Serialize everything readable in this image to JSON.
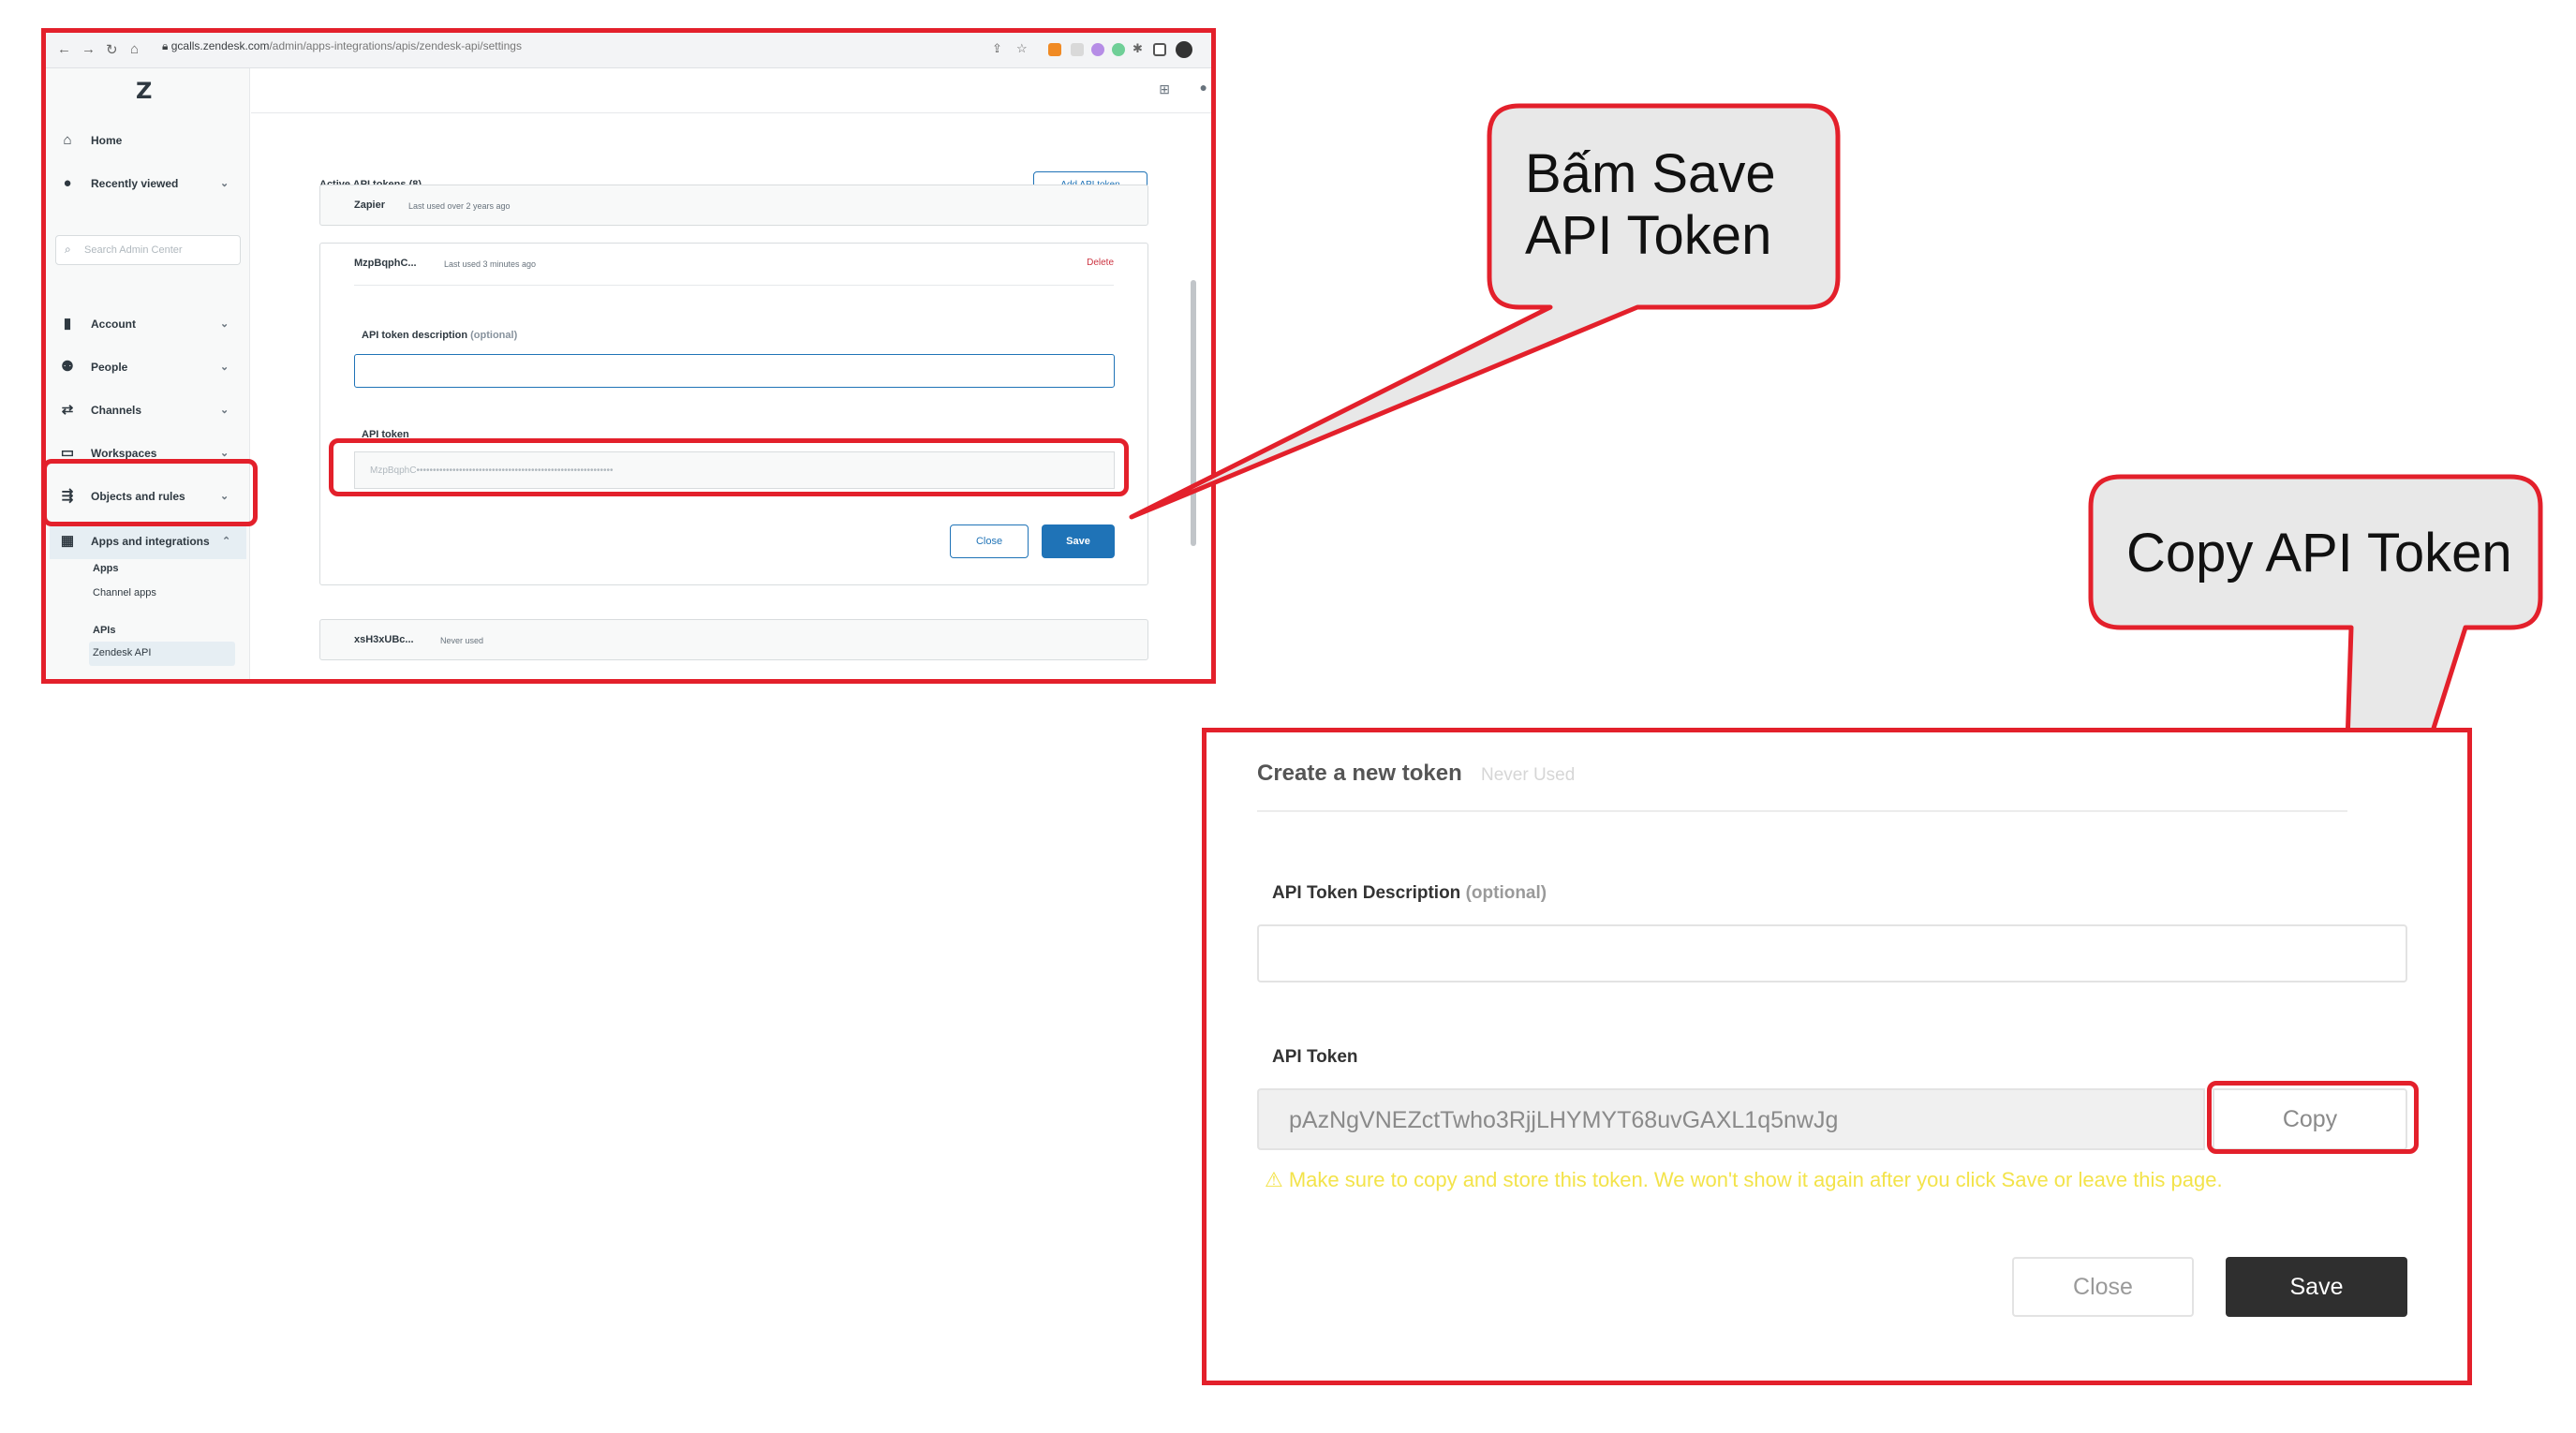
{
  "browser": {
    "url_host": "gcalls.zendesk.com",
    "url_path": "/admin/apps-integrations/apis/zendesk-api/settings"
  },
  "sidebar": {
    "logo": "Z",
    "search_placeholder": "Search Admin Center",
    "items": [
      {
        "label": "Home",
        "icon": "home-icon"
      },
      {
        "label": "Recently viewed",
        "icon": "clock-icon"
      },
      {
        "label": "Account",
        "icon": "building-icon"
      },
      {
        "label": "People",
        "icon": "people-icon"
      },
      {
        "label": "Channels",
        "icon": "arrows-icon"
      },
      {
        "label": "Workspaces",
        "icon": "monitor-icon"
      },
      {
        "label": "Objects and rules",
        "icon": "flow-icon"
      },
      {
        "label": "Apps and integrations",
        "icon": "grid-icon"
      }
    ],
    "sub": {
      "apps": "Apps",
      "channel_apps": "Channel apps",
      "apis": "APIs",
      "zendesk_api": "Zendesk API"
    }
  },
  "main": {
    "active_header": "Active API tokens (8)",
    "add_token": "Add API token",
    "tokens": [
      {
        "name": "Zapier",
        "note": "Last used over 2 years ago"
      },
      {
        "name": "MzpBqphC...",
        "note": "Last used 3 minutes ago"
      },
      {
        "name": "xsH3xUBc...",
        "note": "Never used"
      }
    ],
    "delete": "Delete",
    "desc_label": "API token description",
    "optional": "(optional)",
    "token_label": "API token",
    "token_masked": "MzpBqphC••••••••••••••••••••••••••••••••••••••••••••••••••••••••••••",
    "close": "Close",
    "save": "Save"
  },
  "callouts": {
    "save_line1": "Bấm Save",
    "save_line2": "API Token",
    "copy": "Copy API Token"
  },
  "zoom": {
    "title": "Create a new token",
    "status": "Never Used",
    "desc_label": "API Token Description",
    "optional": "(optional)",
    "token_label": "API Token",
    "token_value": "pAzNgVNEZctTwho3RjjLHYMYT68uvGAXL1q5nwJg",
    "copy": "Copy",
    "warning": "⚠ Make sure to copy and store this token. We won't show it again after you click Save or leave this page.",
    "close": "Close",
    "save": "Save"
  },
  "colors": {
    "highlight": "#e3202b",
    "zendesk_blue": "#1f73b7",
    "warning": "#f3e34a"
  }
}
